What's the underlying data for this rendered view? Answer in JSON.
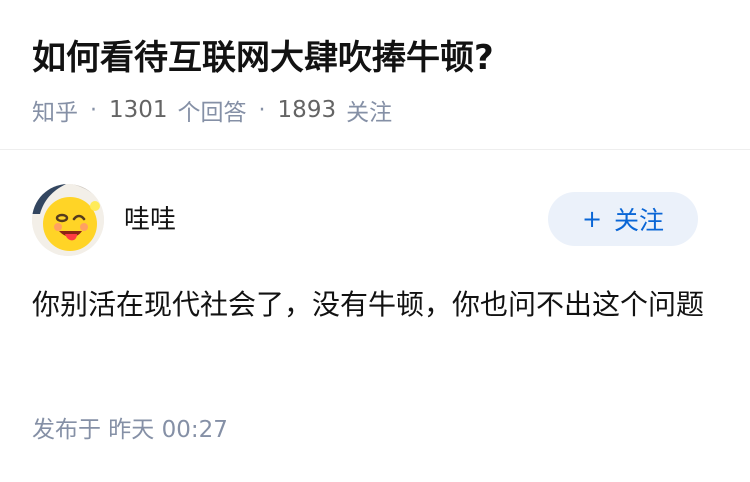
{
  "question": {
    "title": "如何看待互联网大肆吹捧牛顿?",
    "source": "知乎",
    "answer_count": "1301",
    "answer_label": "个回答",
    "follow_count": "1893",
    "follow_label": "关注",
    "separator": "·"
  },
  "answer": {
    "author": {
      "name": "哇哇",
      "avatar_icon": "smiling-emoji-avatar"
    },
    "follow_button": {
      "icon": "plus-icon",
      "icon_glyph": "+",
      "label": "关注"
    },
    "content": "你别活在现代社会了，没有牛顿，你也问不出这个问题",
    "published": "发布于  昨天 00:27"
  },
  "colors": {
    "accent": "#0a66d6",
    "follow_bg": "#ebf1fa",
    "meta_text": "#8590a6"
  }
}
